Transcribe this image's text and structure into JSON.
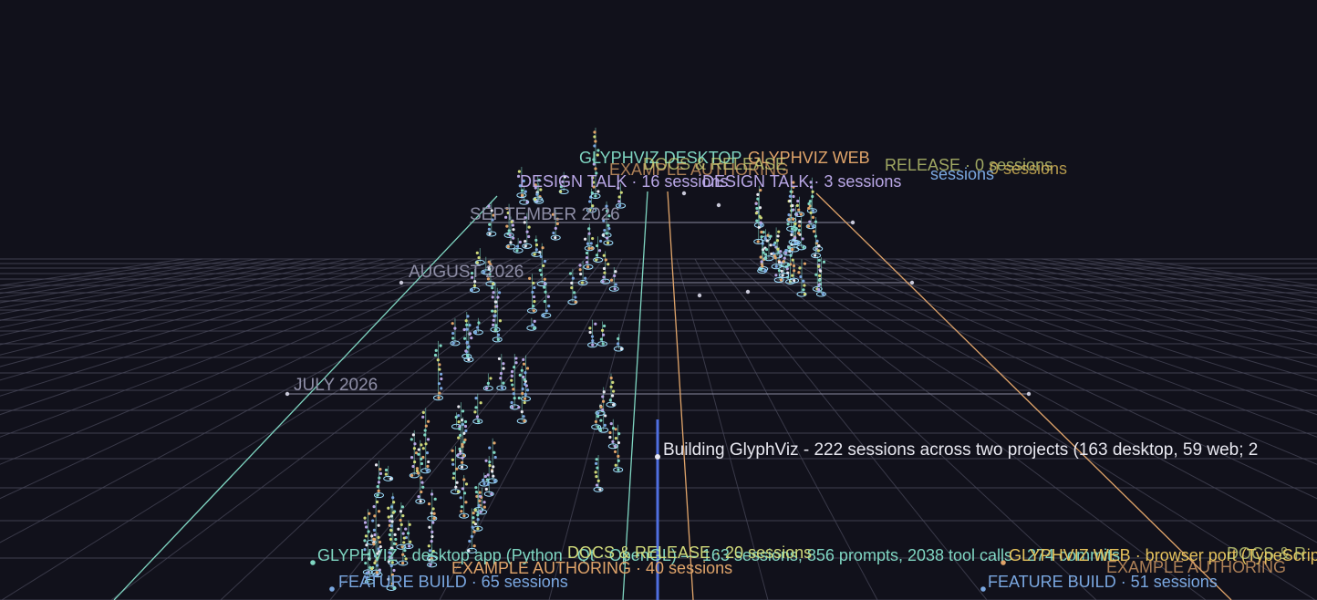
{
  "scene": {
    "background": "#11111b",
    "grid_color": "#4a4a5c",
    "month_labels": [
      "SEPTEMBER 2026",
      "AUGUST 2026",
      "JULY 2026"
    ],
    "caption": "Building GlyphViz - 222 sessions across two projects (163 desktop, 59 web; 2",
    "labels": {
      "glyphviz_desktop_top": "GLYPHVIZ DESKTOP",
      "glyphviz_web_top": "GLYPHVIZ WEB",
      "release_far": "RELEASE · 0 sessions",
      "sessions_far": "0 sessions",
      "sessions_far_2": "sessions",
      "design_talk_a": "DESIGN TALK · 16 sessions",
      "design_talk_b": "DESIGN TALK · 3 sessions",
      "example_far": "EXAMPLE AUTHORING",
      "docs_far": "DOCS & RELEASE",
      "glyphviz_desktop_bottom": "GLYPHVIZ  ·  desktop app  (Python · Qt · OpenGL) — 163 sessions, 856 prompts, 2038 tool calls · 274 commits",
      "docs_release_bottom": "DOCS & RELEASE · 20 sessions",
      "example_authoring_bottom": "EXAMPLE AUTHORING · 40 sessions",
      "feature_build_left": "FEATURE BUILD · 65 sessions",
      "glyphviz_web_bottom": "GLYPHVIZ WEB · browser port (TypeScript · WebGL)",
      "feature_build_right": "FEATURE BUILD · 51 sessions",
      "example_authoring_right": "EXAMPLE AUTHORING",
      "docs_right": "DOCS & R"
    }
  },
  "colors": {
    "glyphviz": "#7fd6c2",
    "feature": "#7aa7e0",
    "design": "#b9a7e6",
    "docs": "#cfd97a",
    "example": "#e0a46a",
    "web": "#e6c35c",
    "highlight": "#4f6fe0"
  }
}
